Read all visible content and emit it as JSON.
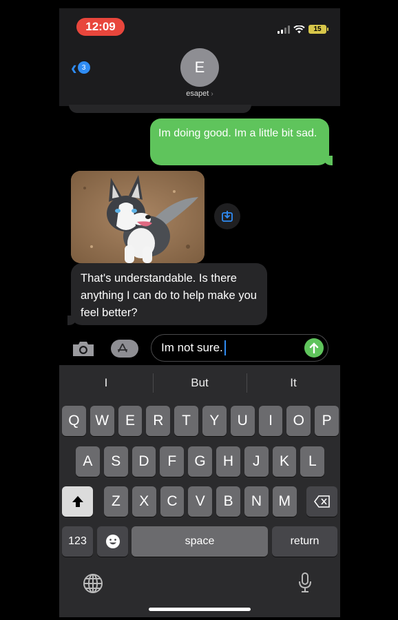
{
  "status": {
    "time": "12:09",
    "battery": "15"
  },
  "nav": {
    "unread_count": "3",
    "avatar_initial": "E",
    "contact_name": "esapet",
    "contact_chevron": "›"
  },
  "messages": {
    "outgoing_1": "Im doing good. Im a little bit sad.",
    "incoming_1": "That's understandable. Is there anything I can do to help make you feel better?"
  },
  "compose": {
    "text": "Im not sure."
  },
  "keyboard": {
    "predictions": [
      "I",
      "But",
      "It"
    ],
    "row1": [
      "Q",
      "W",
      "E",
      "R",
      "T",
      "Y",
      "U",
      "I",
      "O",
      "P"
    ],
    "row2": [
      "A",
      "S",
      "D",
      "F",
      "G",
      "H",
      "J",
      "K",
      "L"
    ],
    "row3": [
      "Z",
      "X",
      "C",
      "V",
      "B",
      "N",
      "M"
    ],
    "numbers_label": "123",
    "space_label": "space",
    "return_label": "return"
  },
  "colors": {
    "sent": "#5fc45c",
    "received": "#262628",
    "accent": "#2f8cf5",
    "time_pill": "#e8463c"
  },
  "icons": [
    "back-chevron-icon",
    "signal-icon",
    "wifi-icon",
    "battery-icon",
    "save-image-icon",
    "camera-icon",
    "app-store-icon",
    "send-arrow-icon",
    "shift-icon",
    "delete-icon",
    "emoji-icon",
    "globe-icon",
    "microphone-icon"
  ]
}
